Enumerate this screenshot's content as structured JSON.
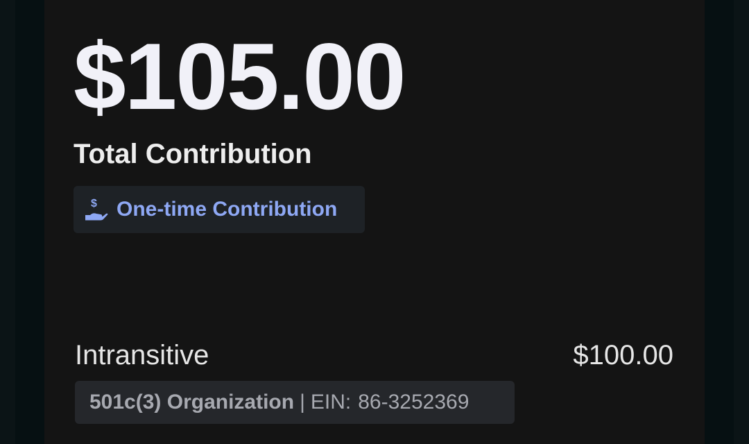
{
  "summary": {
    "total_amount": "$105.00",
    "total_label": "Total Contribution",
    "frequency": {
      "label": "One-time Contribution",
      "icon": "hand-dollar-icon",
      "accent_color": "#8ea8f4"
    }
  },
  "line_items": [
    {
      "name": "Intransitive",
      "amount": "$100.00",
      "org_type": "501c(3) Organization",
      "separator": "|",
      "ein_label": "EIN:",
      "ein_value": "86-3252369"
    }
  ],
  "colors": {
    "background": "#141414",
    "text_primary": "#f1f1f8",
    "chip_background": "#1e2226",
    "badge_background": "#25272b"
  }
}
